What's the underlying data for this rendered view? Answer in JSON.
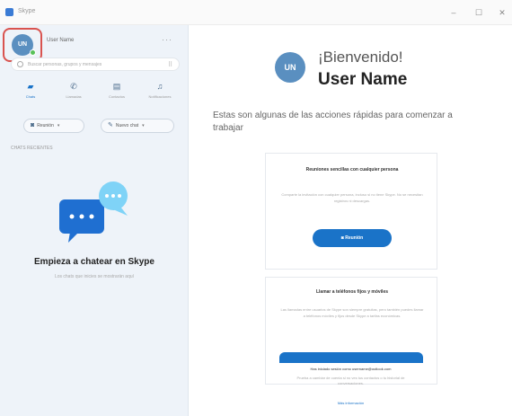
{
  "window": {
    "title": "Skype",
    "controls": [
      "–",
      "☐",
      "✕"
    ]
  },
  "sidebar": {
    "profile": {
      "initials": "UN",
      "name": "User Name",
      "more": "···"
    },
    "search": {
      "placeholder": "Buscar personas, grupos y mensajes"
    },
    "nav": [
      {
        "label": "Chats",
        "icon": "chat-icon"
      },
      {
        "label": "Llamadas",
        "icon": "phone-icon"
      },
      {
        "label": "Contactos",
        "icon": "contacts-icon"
      },
      {
        "label": "Notificaciones",
        "icon": "bell-icon"
      }
    ],
    "pills": [
      {
        "label": "Reunión",
        "icon": "video-icon"
      },
      {
        "label": "Nuevo chat",
        "icon": "edit-icon"
      }
    ],
    "section_label": "CHATS RECIENTES",
    "empty_title": "Empieza a chatear en Skype",
    "empty_subtitle": "Los chats que inicies se mostrarán aquí"
  },
  "main": {
    "avatar_initials": "UN",
    "welcome": "¡Bienvenido!",
    "username": "User Name",
    "intro": "Estas son algunas de las acciones rápidas para comenzar a trabajar",
    "card1": {
      "title": "Reuniones sencillas con cualquier persona",
      "body": "Comparte la invitación con cualquier persona, incluso si no tiene Skype. No se necesitan registros ni descargas.",
      "button": "Reunión"
    },
    "card2": {
      "title": "Llamar a teléfonos fijos y móviles",
      "body": "Las llamadas entre usuarios de Skype son siempre gratuitas, pero también puedes llamar a teléfonos móviles y fijos desde Skype a tarifas económicas."
    },
    "footer": {
      "signed_in": "Has iniciado sesión como username@outlook.com",
      "notice_1": "Prueba a cambiar de cuenta si no ves tus contactos o tu historial de",
      "notice_2": "conversaciones.",
      "link": "Más información"
    }
  },
  "colors": {
    "accent": "#1a73c8",
    "highlight": "#d9534f",
    "presence": "#58c158"
  }
}
